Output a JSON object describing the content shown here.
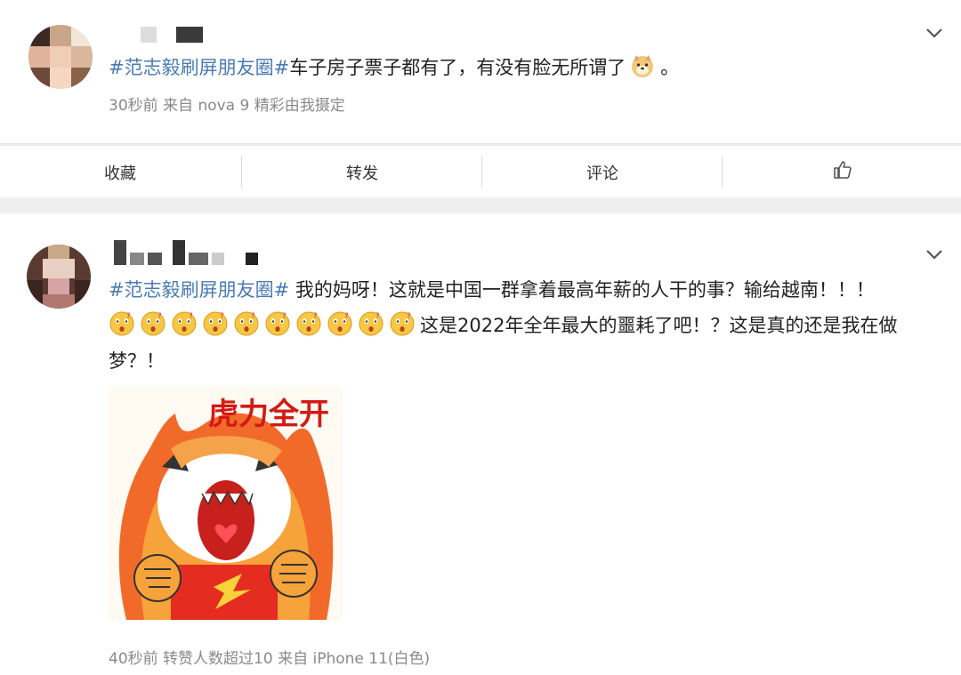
{
  "post1": {
    "topic": "#范志毅刷屏朋友圈#",
    "text": "车子房子票子都有了，有没有脸无所谓了",
    "text_end": "。",
    "emoji_icon": "doge-emoji-icon",
    "meta": "30秒前  来自 nova 9 精彩由我摄定"
  },
  "actions": {
    "favorite_label": "收藏",
    "repost_label": "转发",
    "comment_label": "评论",
    "like_icon": "thumbs-up-icon"
  },
  "post2": {
    "topic": "#范志毅刷屏朋友圈#",
    "line1": " 我的妈呀！这就是中国一群拿着最高年薪的人干的事？输给越南！！！",
    "line2": "这是2022年全年最大的噩耗了吧！？这是真的还是我在做",
    "line3": "梦？！",
    "emoji_icon": "surprised-emoji-icon",
    "emoji_count": 10,
    "sticker_text": "虎力全开",
    "meta": "40秒前 转赞人数超过10  来自 iPhone 11(白色)"
  },
  "colors": {
    "topic": "#4a7bb4",
    "meta": "#8a8a8a",
    "background": "#efefef"
  }
}
